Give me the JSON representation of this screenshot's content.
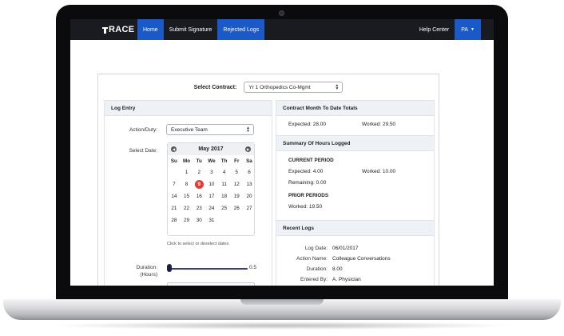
{
  "navbar": {
    "logo": "RACE",
    "items": [
      {
        "label": "Home",
        "active": true
      },
      {
        "label": "Submit Signature",
        "active": false
      },
      {
        "label": "Rejected Logs",
        "active": true
      }
    ],
    "help": "Help Center",
    "user": "PA",
    "accent": "#1b58c8"
  },
  "contract": {
    "label": "Select Contract:",
    "value": "Yr 1 Orthopedics Co-Mgmt"
  },
  "log_entry": {
    "title": "Log Entry",
    "action_label": "Action/Duty:",
    "action_value": "Executive Team",
    "date_label": "Select Date:",
    "calendar": {
      "month": "May 2017",
      "weekdays": [
        "Su",
        "Mo",
        "Tu",
        "We",
        "Th",
        "Fr",
        "Sa"
      ],
      "start_offset": 1,
      "days_in_month": 31,
      "selected_day": 9,
      "selected_color": "#e53935"
    },
    "hint": "Click to select or deselect dates",
    "duration_label_1": "Duration:",
    "duration_label_2": "(Hours)",
    "duration_value": "0.5"
  },
  "totals": {
    "title": "Contract Month To Date Totals",
    "expected": "Expected: 28.00",
    "worked": "Worked: 29.50"
  },
  "summary": {
    "title": "Summary Of Hours Logged",
    "current_title": "CURRENT PERIOD",
    "current_expected": "Expected: 4.00",
    "current_worked": "Worked: 10.00",
    "current_remaining": "Remaining: 0.00",
    "prior_title": "PRIOR PERIODS",
    "prior_worked": "Worked: 19.50"
  },
  "recent_logs": {
    "title": "Recent Logs",
    "entries": [
      {
        "label": "Log Date:",
        "value": "06/01/2017"
      },
      {
        "label": "Action Name:",
        "value": "Colleague Conversations"
      },
      {
        "label": "Duration:",
        "value": "8.00"
      },
      {
        "label": "Entered By:",
        "value": "A. Physician"
      }
    ]
  }
}
